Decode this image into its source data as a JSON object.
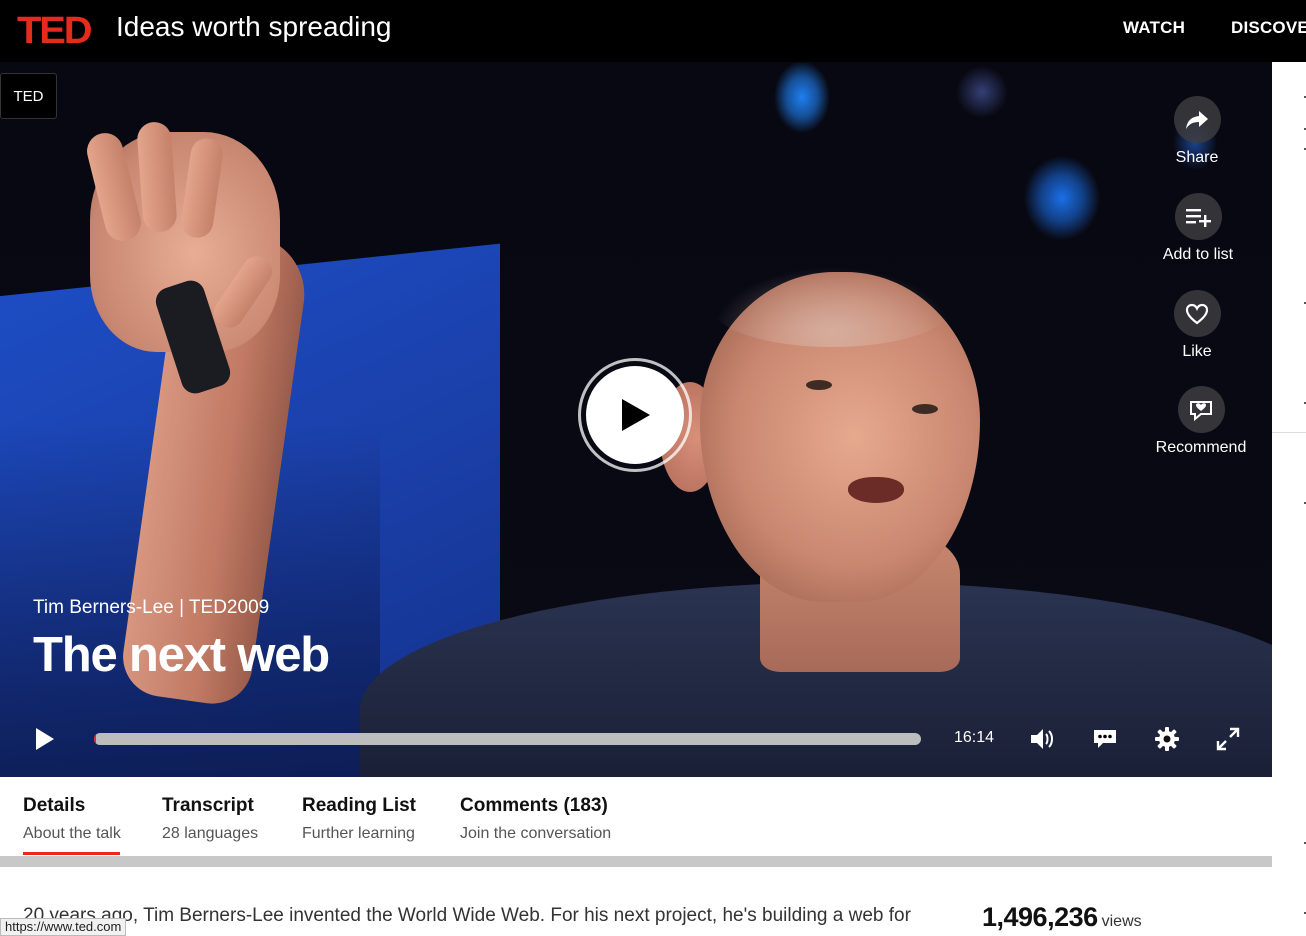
{
  "header": {
    "logo": "TED",
    "tagline": "Ideas worth spreading",
    "nav": [
      "WATCH",
      "DISCOVE"
    ]
  },
  "video": {
    "badge": "TED",
    "speaker_event": "Tim Berners-Lee | TED2009",
    "title": "The next web",
    "duration": "16:14",
    "progress_fraction": 0.0,
    "accent_color": "#e62b1e",
    "actions": [
      {
        "label": "Share",
        "icon": "share-icon"
      },
      {
        "label": "Add to list",
        "icon": "playlist-add-icon"
      },
      {
        "label": "Like",
        "icon": "heart-icon"
      },
      {
        "label": "Recommend",
        "icon": "recommend-icon"
      }
    ]
  },
  "tabs": [
    {
      "title": "Details",
      "subtitle": "About the talk",
      "active": true
    },
    {
      "title": "Transcript",
      "subtitle": "28 languages",
      "active": false
    },
    {
      "title": "Reading List",
      "subtitle": "Further learning",
      "active": false
    },
    {
      "title": "Comments (183)",
      "subtitle": "Join the conversation",
      "active": false
    }
  ],
  "details": {
    "description": "20 years ago, Tim Berners-Lee invented the World Wide Web. For his next project, he's building a web for",
    "views_count": "1,496,236",
    "views_label": "views"
  },
  "status_bar": {
    "url": "https://www.ted.com"
  }
}
